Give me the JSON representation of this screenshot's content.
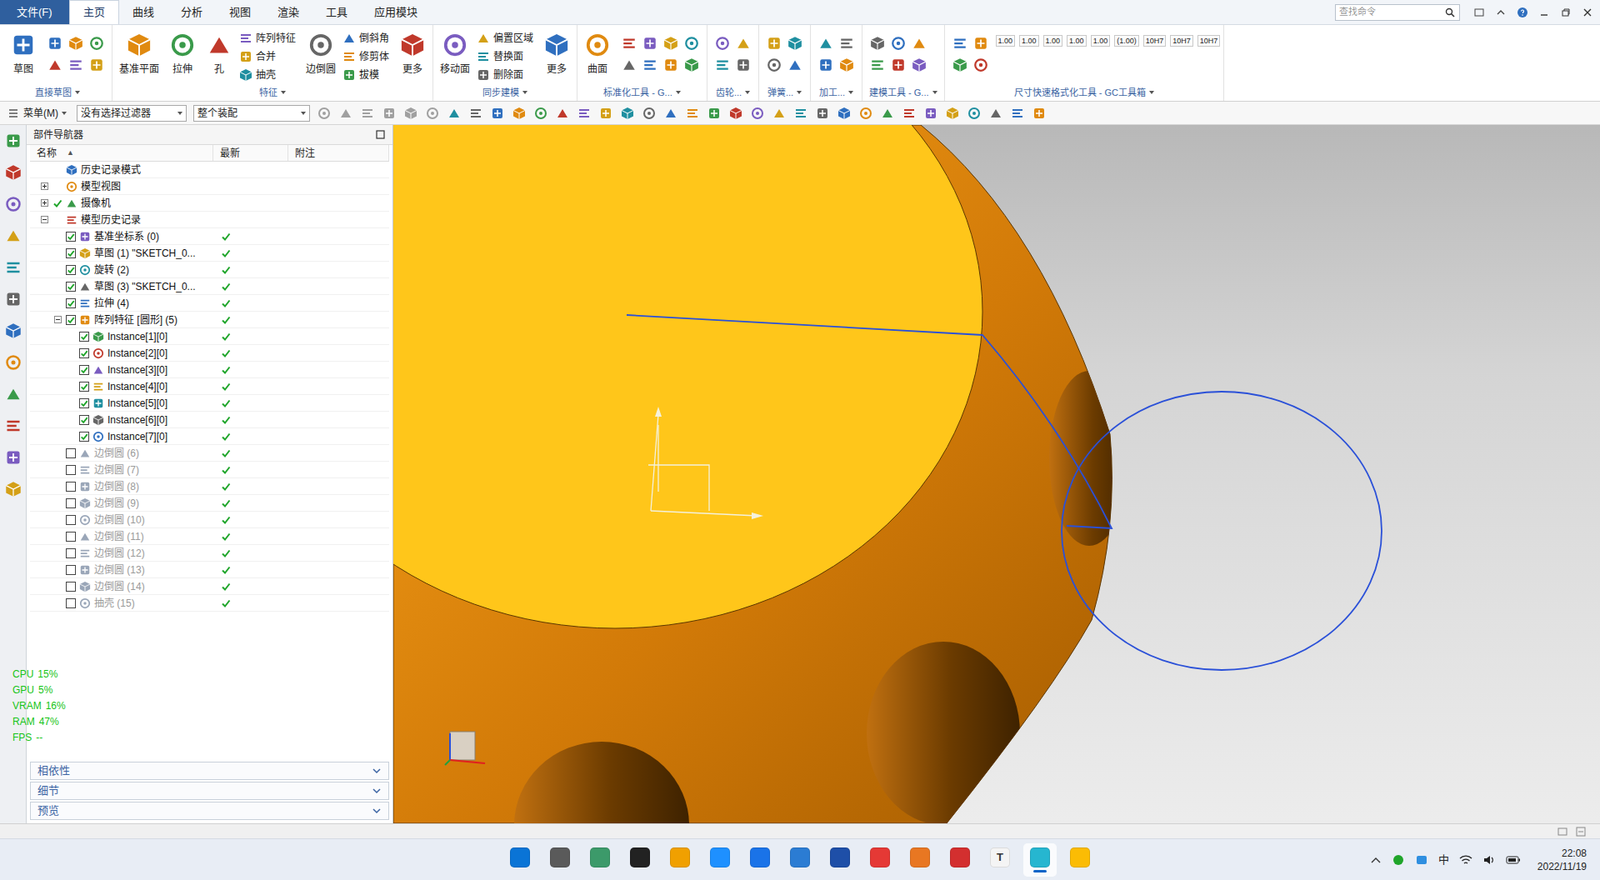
{
  "menu": {
    "file": "文件(F)",
    "tabs": [
      {
        "label": "主页",
        "selected": true
      },
      {
        "label": "曲线",
        "selected": false
      },
      {
        "label": "分析",
        "selected": false
      },
      {
        "label": "视图",
        "selected": false
      },
      {
        "label": "渲染",
        "selected": false
      },
      {
        "label": "工具",
        "selected": false
      },
      {
        "label": "应用模块",
        "selected": false
      }
    ],
    "search": {
      "placeholder": "查找命令"
    }
  },
  "ribbon": {
    "groups": [
      {
        "label": "直接草图",
        "items": [
          {
            "kind": "big",
            "label": "草图"
          },
          {
            "kind": "icons"
          }
        ]
      },
      {
        "label": "特征",
        "items": [
          {
            "kind": "big",
            "label": "基准平面"
          },
          {
            "kind": "big",
            "label": "拉伸"
          },
          {
            "kind": "big",
            "label": "孔"
          },
          {
            "kind": "small",
            "labels": [
              "阵列特征",
              "合并",
              "抽壳"
            ]
          },
          {
            "kind": "big",
            "label": "边倒圆"
          },
          {
            "kind": "small",
            "labels": [
              "倒斜角",
              "修剪体",
              "拔模"
            ]
          },
          {
            "kind": "big",
            "label": "更多"
          }
        ]
      },
      {
        "label": "同步建模",
        "items": [
          {
            "kind": "big",
            "label": "移动面"
          },
          {
            "kind": "small",
            "labels": [
              "偏置区域",
              "替换面",
              "删除面"
            ]
          },
          {
            "kind": "big",
            "label": "更多"
          }
        ]
      },
      {
        "label": "标准化工具 - G...",
        "items": [
          {
            "kind": "big",
            "label": "曲面"
          },
          {
            "kind": "icons"
          }
        ]
      },
      {
        "label": "齿轮...",
        "items": [
          {
            "kind": "icons"
          }
        ]
      },
      {
        "label": "弹簧...",
        "items": [
          {
            "kind": "icons"
          }
        ]
      },
      {
        "label": "加工...",
        "items": [
          {
            "kind": "icons"
          }
        ]
      },
      {
        "label": "建模工具 - G...",
        "items": [
          {
            "kind": "icons"
          }
        ]
      },
      {
        "label": "尺寸快速格式化工具 - GC工具箱",
        "items": [
          {
            "kind": "icons"
          },
          {
            "kind": "texts",
            "labels": [
              "1.00",
              "1.00",
              "1.00",
              "1.00",
              "1.00",
              "(1.00)",
              "10H7",
              "10H7",
              "10H7"
            ]
          }
        ]
      }
    ]
  },
  "toolbar": {
    "menu": "菜单(M)",
    "filter": "没有选择过滤器",
    "scope": "整个装配"
  },
  "navigator": {
    "title": "部件导航器",
    "columns": [
      "名称",
      "最新",
      "附注"
    ],
    "sort_arrow": "▲",
    "rows": [
      {
        "label": "历史记录模式",
        "depth": 0,
        "has_children": false,
        "expanded": false,
        "checkbox": false,
        "checked": false,
        "latest": false,
        "greyed": false
      },
      {
        "label": "模型视图",
        "depth": 0,
        "has_children": true,
        "expanded": false,
        "checkbox": false,
        "checked": false,
        "latest": false,
        "greyed": false
      },
      {
        "label": "摄像机",
        "depth": 0,
        "has_children": true,
        "expanded": false,
        "checkbox": false,
        "checked": true,
        "latest": false,
        "greyed": false
      },
      {
        "label": "模型历史记录",
        "depth": 0,
        "has_children": true,
        "expanded": true,
        "checkbox": false,
        "checked": false,
        "latest": false,
        "greyed": false
      },
      {
        "label": "基准坐标系 (0)",
        "depth": 1,
        "has_children": false,
        "expanded": false,
        "checkbox": true,
        "checked": true,
        "latest": true,
        "greyed": false
      },
      {
        "label": "草图 (1) \"SKETCH_0...",
        "depth": 1,
        "has_children": false,
        "expanded": false,
        "checkbox": true,
        "checked": true,
        "latest": true,
        "greyed": false
      },
      {
        "label": "旋转 (2)",
        "depth": 1,
        "has_children": false,
        "expanded": false,
        "checkbox": true,
        "checked": true,
        "latest": true,
        "greyed": false
      },
      {
        "label": "草图 (3) \"SKETCH_0...",
        "depth": 1,
        "has_children": false,
        "expanded": false,
        "checkbox": true,
        "checked": true,
        "latest": true,
        "greyed": false
      },
      {
        "label": "拉伸 (4)",
        "depth": 1,
        "has_children": false,
        "expanded": false,
        "checkbox": true,
        "checked": true,
        "latest": true,
        "greyed": false
      },
      {
        "label": "阵列特征 [圆形] (5)",
        "depth": 1,
        "has_children": true,
        "expanded": true,
        "checkbox": true,
        "checked": true,
        "latest": true,
        "greyed": false
      },
      {
        "label": "Instance[1][0]",
        "depth": 2,
        "has_children": false,
        "expanded": false,
        "checkbox": true,
        "checked": true,
        "latest": true,
        "greyed": false
      },
      {
        "label": "Instance[2][0]",
        "depth": 2,
        "has_children": false,
        "expanded": false,
        "checkbox": true,
        "checked": true,
        "latest": true,
        "greyed": false
      },
      {
        "label": "Instance[3][0]",
        "depth": 2,
        "has_children": false,
        "expanded": false,
        "checkbox": true,
        "checked": true,
        "latest": true,
        "greyed": false
      },
      {
        "label": "Instance[4][0]",
        "depth": 2,
        "has_children": false,
        "expanded": false,
        "checkbox": true,
        "checked": true,
        "latest": true,
        "greyed": false
      },
      {
        "label": "Instance[5][0]",
        "depth": 2,
        "has_children": false,
        "expanded": false,
        "checkbox": true,
        "checked": true,
        "latest": true,
        "greyed": false
      },
      {
        "label": "Instance[6][0]",
        "depth": 2,
        "has_children": false,
        "expanded": false,
        "checkbox": true,
        "checked": true,
        "latest": true,
        "greyed": false
      },
      {
        "label": "Instance[7][0]",
        "depth": 2,
        "has_children": false,
        "expanded": false,
        "checkbox": true,
        "checked": true,
        "latest": true,
        "greyed": false
      },
      {
        "label": "边倒圆 (6)",
        "depth": 1,
        "has_children": false,
        "expanded": false,
        "checkbox": true,
        "checked": false,
        "latest": true,
        "greyed": true
      },
      {
        "label": "边倒圆 (7)",
        "depth": 1,
        "has_children": false,
        "expanded": false,
        "checkbox": true,
        "checked": false,
        "latest": true,
        "greyed": true
      },
      {
        "label": "边倒圆 (8)",
        "depth": 1,
        "has_children": false,
        "expanded": false,
        "checkbox": true,
        "checked": false,
        "latest": true,
        "greyed": true
      },
      {
        "label": "边倒圆 (9)",
        "depth": 1,
        "has_children": false,
        "expanded": false,
        "checkbox": true,
        "checked": false,
        "latest": true,
        "greyed": true
      },
      {
        "label": "边倒圆 (10)",
        "depth": 1,
        "has_children": false,
        "expanded": false,
        "checkbox": true,
        "checked": false,
        "latest": true,
        "greyed": true
      },
      {
        "label": "边倒圆 (11)",
        "depth": 1,
        "has_children": false,
        "expanded": false,
        "checkbox": true,
        "checked": false,
        "latest": true,
        "greyed": true
      },
      {
        "label": "边倒圆 (12)",
        "depth": 1,
        "has_children": false,
        "expanded": false,
        "checkbox": true,
        "checked": false,
        "latest": true,
        "greyed": true
      },
      {
        "label": "边倒圆 (13)",
        "depth": 1,
        "has_children": false,
        "expanded": false,
        "checkbox": true,
        "checked": false,
        "latest": true,
        "greyed": true
      },
      {
        "label": "边倒圆 (14)",
        "depth": 1,
        "has_children": false,
        "expanded": false,
        "checkbox": true,
        "checked": false,
        "latest": true,
        "greyed": true
      },
      {
        "label": "抽壳 (15)",
        "depth": 1,
        "has_children": false,
        "expanded": false,
        "checkbox": true,
        "checked": false,
        "latest": true,
        "greyed": true
      }
    ],
    "panels": [
      {
        "label": "相依性"
      },
      {
        "label": "细节"
      },
      {
        "label": "预览"
      }
    ]
  },
  "stats": [
    {
      "label": "CPU",
      "value": "15%"
    },
    {
      "label": "GPU",
      "value": "5%"
    },
    {
      "label": "VRAM",
      "value": "16%"
    },
    {
      "label": "RAM",
      "value": "47%"
    },
    {
      "label": "FPS",
      "value": "--"
    }
  ],
  "taskbar": {
    "apps": [
      {
        "glyph": "",
        "color": "#0a74d6",
        "selected": false
      },
      {
        "glyph": "",
        "color": "#5a5a5a",
        "selected": false
      },
      {
        "glyph": "",
        "color": "#3c9a6a",
        "selected": false
      },
      {
        "glyph": "",
        "color": "#222222",
        "selected": false
      },
      {
        "glyph": "",
        "color": "#f0a000",
        "selected": false
      },
      {
        "glyph": "",
        "color": "#1e90ff",
        "selected": false
      },
      {
        "glyph": "",
        "color": "#1a73e8",
        "selected": false
      },
      {
        "glyph": "",
        "color": "#2b7cd3",
        "selected": false
      },
      {
        "glyph": "",
        "color": "#1e4fa8",
        "selected": false
      },
      {
        "glyph": "",
        "color": "#e53935",
        "selected": false
      },
      {
        "glyph": "",
        "color": "#e87722",
        "selected": false
      },
      {
        "glyph": "",
        "color": "#d32f2f",
        "selected": false
      },
      {
        "glyph": "T",
        "color": "#f4f4f4",
        "selected": false
      },
      {
        "glyph": "",
        "color": "#26b6d0",
        "selected": true
      },
      {
        "glyph": "",
        "color": "#fbbc04",
        "selected": false
      }
    ],
    "tray": {
      "ime": "中",
      "time": "22:08",
      "date": "2022/11/19"
    }
  }
}
